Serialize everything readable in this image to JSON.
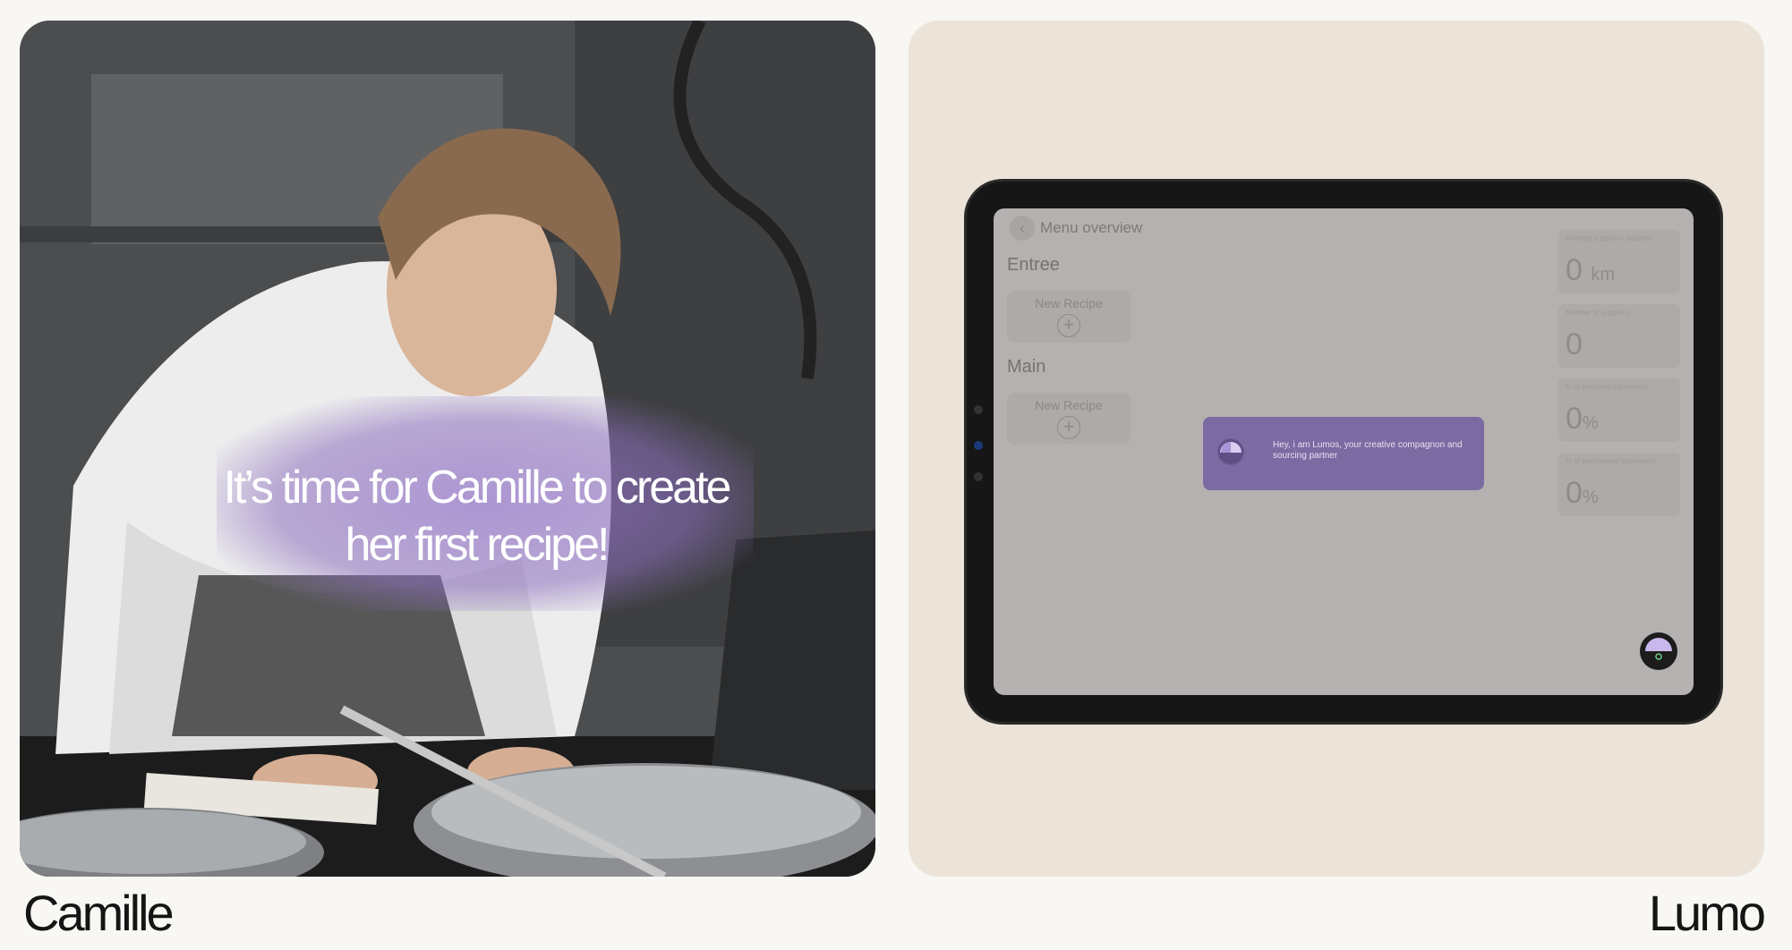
{
  "left_panel": {
    "caption": "It’s time for Camille to create her first recipe!",
    "name": "Camille"
  },
  "right_panel": {
    "name": "Lumo",
    "app": {
      "header_title": "Menu overview",
      "sections": [
        {
          "label": "Entree",
          "tile_label": "New Recipe"
        },
        {
          "label": "Main",
          "tile_label": "New Recipe"
        }
      ],
      "stats": [
        {
          "label": "Average suppliers' distance",
          "value": "0",
          "unit": "km"
        },
        {
          "label": "Number of suppliers",
          "value": "0",
          "unit": ""
        },
        {
          "label": "% of seasonal ingredients",
          "value": "0",
          "unit": "%"
        },
        {
          "label": "% of plant based ingredients",
          "value": "0",
          "unit": "%"
        }
      ],
      "assistant_message": "Hey, i am Lumos, your creative compagnon and sourcing partner"
    }
  },
  "colors": {
    "page_bg": "#f8f7f3",
    "ui_card_bg": "#ece4d8",
    "accent_purple": "#7c6ba3",
    "screen_overlay": "#b5b1b0"
  }
}
